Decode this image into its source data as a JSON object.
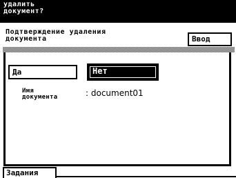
{
  "topbar": {
    "title": "удалить\nдокумент?"
  },
  "header": {
    "title": "Подтверждение удаления\nдокумента",
    "enter_label": "Ввод"
  },
  "dialog": {
    "yes_label": "Да",
    "no_label": "Нет",
    "selected_option": "Нет",
    "name_label": "Имя\nдокумента",
    "name_value": ": document01"
  },
  "bottom": {
    "tab_label": "Задания"
  },
  "colors": {
    "background": "#ffffff",
    "foreground": "#000000",
    "stipple": "#8a8a8a"
  }
}
